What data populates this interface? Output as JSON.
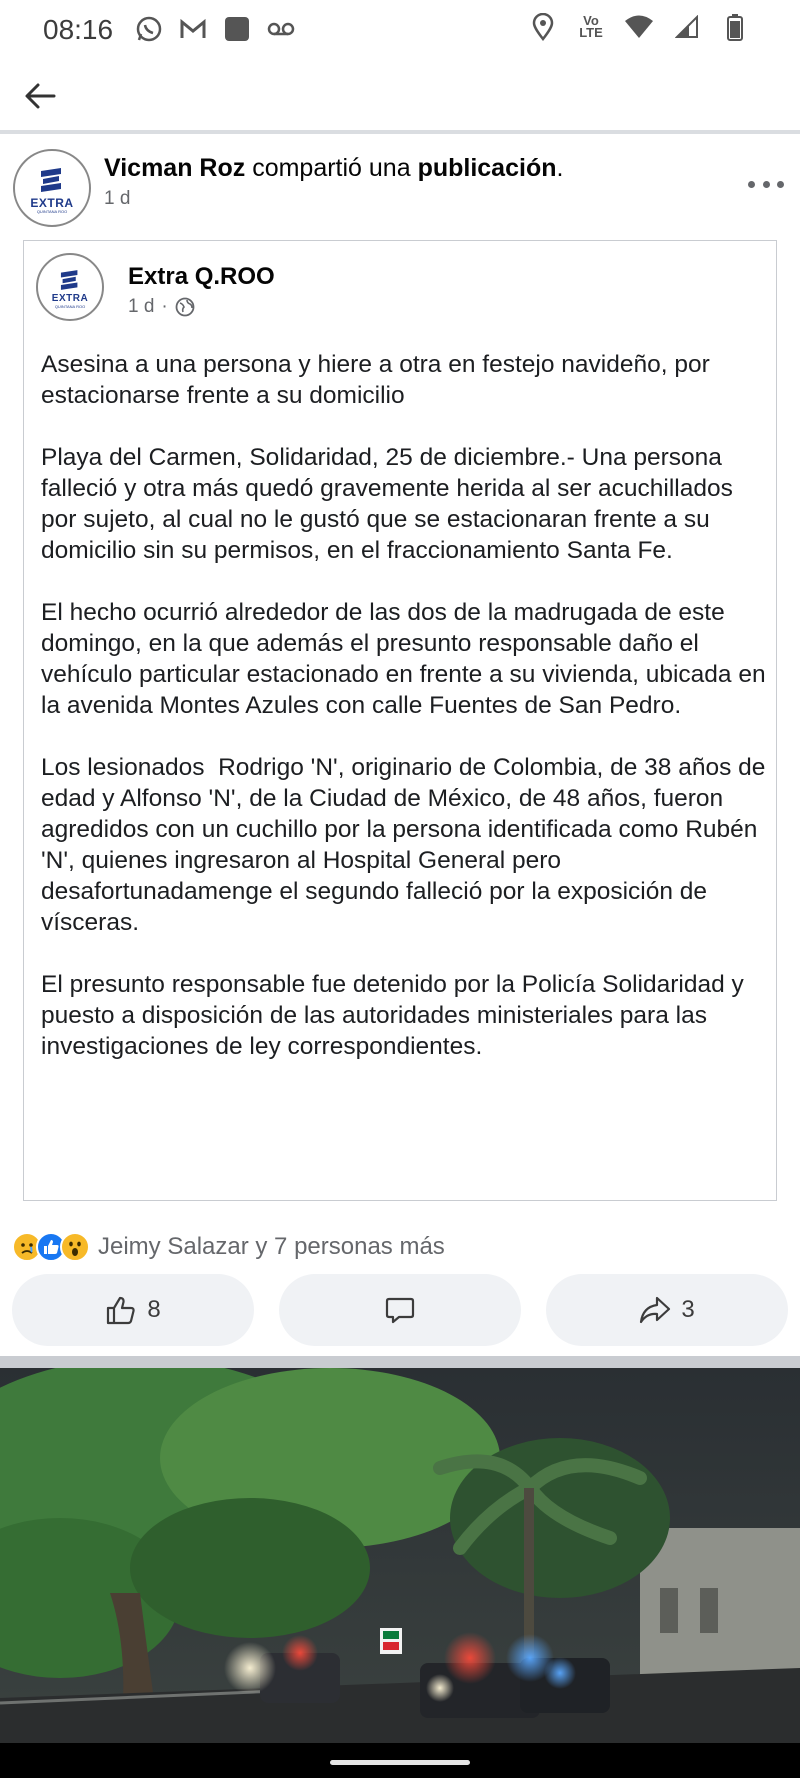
{
  "status_bar": {
    "time": "08:16",
    "left_icons": [
      "whatsapp-icon",
      "gmail-icon",
      "app-square-icon",
      "voicemail-icon"
    ],
    "right_icons": [
      "location-icon",
      "volte-icon",
      "wifi-icon",
      "signal-icon",
      "battery-icon"
    ],
    "volte_label_top": "Vo",
    "volte_label_bottom": "LTE"
  },
  "appbar": {
    "back_icon": "arrow-left-icon"
  },
  "post": {
    "author": "Vicman Roz",
    "action_text": " compartió una ",
    "object_text": "publicación",
    "trailing": ".",
    "time": "1 d",
    "avatar_word": "EXTRA",
    "avatar_sub": "QUINTANA ROO"
  },
  "shared": {
    "page_name": "Extra Q.ROO",
    "time": "1 d",
    "separator": "·",
    "audience_icon": "globe-icon",
    "paragraphs": [
      "Asesina a una persona y hiere a otra en festejo navideño, por estacionarse frente a su domicilio",
      "Playa del Carmen, Solidaridad, 25 de diciembre.- Una persona falleció y otra más quedó gravemente herida al ser acuchillados por sujeto, al cual no le gustó que se estacionaran frente a su domicilio sin su permisos, en el fraccionamiento Santa Fe.",
      "El hecho ocurrió alrededor de las dos de la madrugada de este domingo, en la que además el presunto responsable daño el vehículo particular estacionado en frente a su vivienda, ubicada en la avenida Montes Azules con calle Fuentes de San Pedro.",
      "Los lesionados  Rodrigo 'N', originario de Colombia, de 38 años de edad y Alfonso 'N', de la Ciudad de México, de 48 años, fueron agredidos con un cuchillo por la persona identificada como Rubén 'N', quienes ingresaron al Hospital General pero desafortunadamenge el segundo falleció por la exposición de vísceras.",
      "El presunto responsable fue detenido por la Policía Solidaridad y puesto a disposición de las autoridades ministeriales para las investigaciones de ley correspondientes."
    ]
  },
  "reactions": {
    "icons": [
      "sad-reaction-icon",
      "like-reaction-icon",
      "wow-reaction-icon"
    ],
    "label": "Jeimy Salazar y 7 personas más"
  },
  "actions": {
    "like_count": "8",
    "share_count": "3"
  },
  "colors": {
    "accent": "#1877f2",
    "secondary_text": "#65676b",
    "button_bg": "#f0f2f5",
    "divider": "#c9ccd1"
  }
}
